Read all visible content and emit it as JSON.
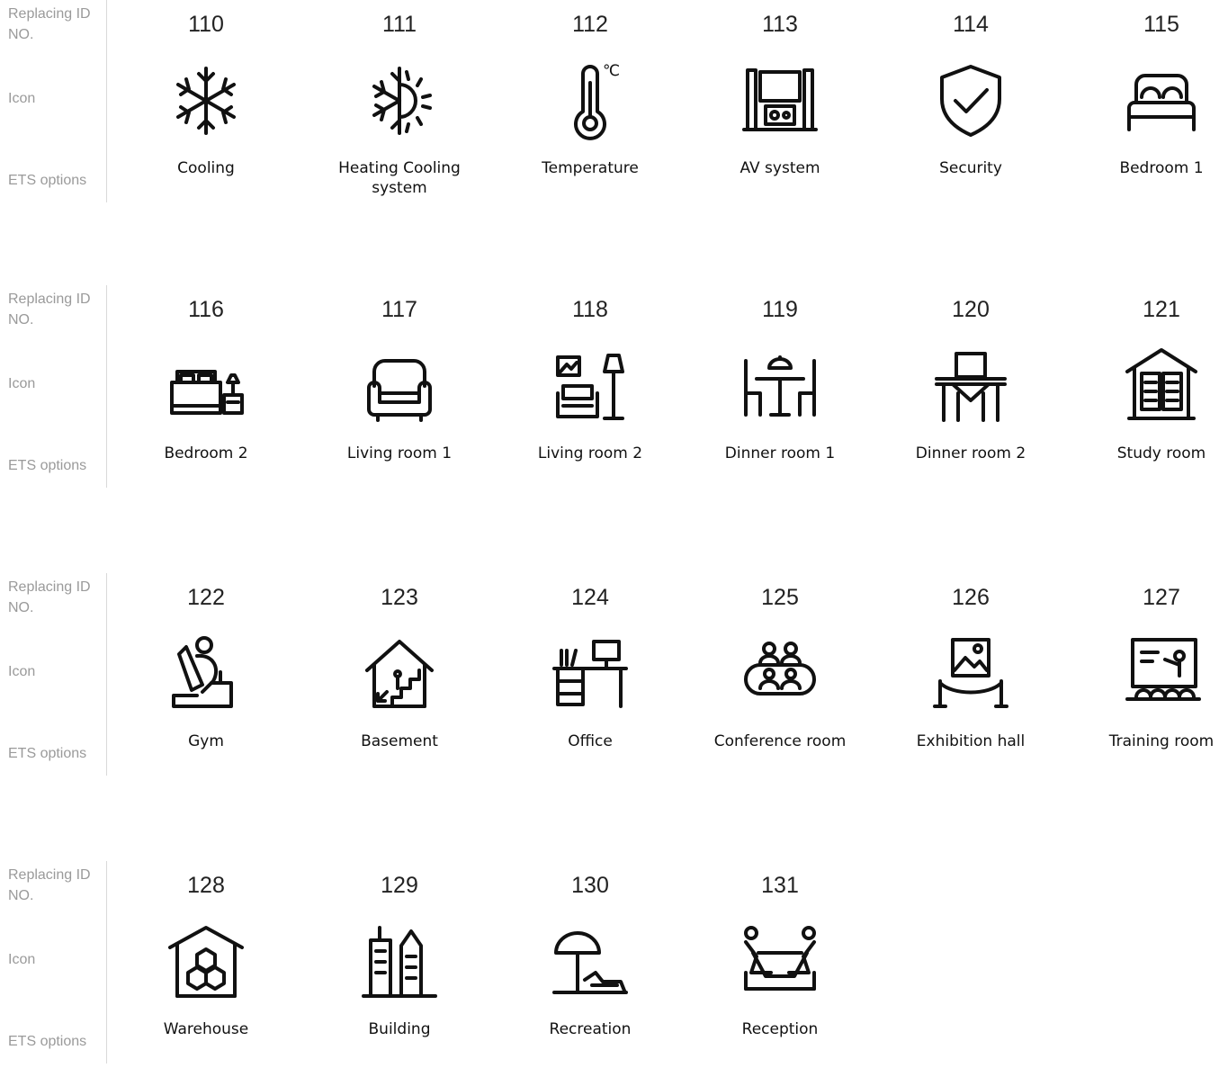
{
  "labels": {
    "replacing_id": "Replacing ID NO.",
    "icon": "Icon",
    "ets": "ETS options"
  },
  "sections": [
    {
      "items": [
        {
          "id": "110",
          "name": "Cooling",
          "icon": "snowflake-icon"
        },
        {
          "id": "111",
          "name": "Heating Cooling system",
          "icon": "snow-sun-icon"
        },
        {
          "id": "112",
          "name": "Temperature",
          "icon": "thermometer-icon"
        },
        {
          "id": "113",
          "name": "AV system",
          "icon": "tv-speakers-icon"
        },
        {
          "id": "114",
          "name": "Security",
          "icon": "shield-check-icon"
        },
        {
          "id": "115",
          "name": "Bedroom 1",
          "icon": "bed-icon"
        }
      ]
    },
    {
      "items": [
        {
          "id": "116",
          "name": "Bedroom 2",
          "icon": "bed-nightstand-icon"
        },
        {
          "id": "117",
          "name": "Living room 1",
          "icon": "armchair-icon"
        },
        {
          "id": "118",
          "name": "Living room 2",
          "icon": "armchair-lamp-icon"
        },
        {
          "id": "119",
          "name": "Dinner room 1",
          "icon": "dining-table-icon"
        },
        {
          "id": "120",
          "name": "Dinner room 2",
          "icon": "table-chair-icon"
        },
        {
          "id": "121",
          "name": "Study room",
          "icon": "book-house-icon"
        }
      ]
    },
    {
      "items": [
        {
          "id": "122",
          "name": "Gym",
          "icon": "gym-icon"
        },
        {
          "id": "123",
          "name": "Basement",
          "icon": "basement-stairs-icon"
        },
        {
          "id": "124",
          "name": "Office",
          "icon": "office-desk-icon"
        },
        {
          "id": "125",
          "name": "Conference room",
          "icon": "conference-icon"
        },
        {
          "id": "126",
          "name": "Exhibition hall",
          "icon": "exhibition-icon"
        },
        {
          "id": "127",
          "name": "Training room",
          "icon": "training-icon"
        }
      ]
    },
    {
      "items": [
        {
          "id": "128",
          "name": "Warehouse",
          "icon": "warehouse-icon"
        },
        {
          "id": "129",
          "name": "Building",
          "icon": "building-icon"
        },
        {
          "id": "130",
          "name": "Recreation",
          "icon": "beach-umbrella-icon"
        },
        {
          "id": "131",
          "name": "Reception",
          "icon": "reception-icon"
        }
      ]
    }
  ],
  "extra_text": {
    "celsius": "℃"
  }
}
